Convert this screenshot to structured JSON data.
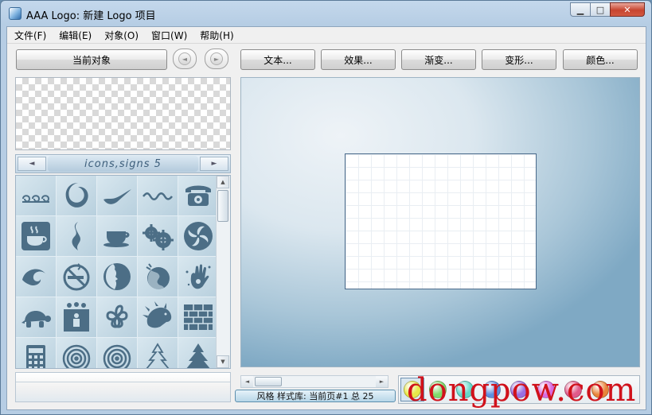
{
  "window": {
    "title": "AAA Logo: 新建 Logo 项目",
    "min_glyph": "▁",
    "max_glyph": "□",
    "close_glyph": "✕"
  },
  "menu": [
    "文件(F)",
    "编辑(E)",
    "对象(O)",
    "窗口(W)",
    "帮助(H)"
  ],
  "toolbar": {
    "current_object": "当前对象",
    "prev_glyph": "◄",
    "next_glyph": "►",
    "text": "文本...",
    "effects": "效果...",
    "gradient": "渐变...",
    "transform": "变形...",
    "color": "颜色..."
  },
  "library": {
    "title": "icons,signs 5",
    "left_glyph": "◄",
    "right_glyph": "►",
    "icons": [
      "swirls-icon",
      "swoosh-ring-icon",
      "checkmark-swoosh-icon",
      "wave-icon",
      "telephone-icon",
      "coffee-cup-steam-icon",
      "s-curve-icon",
      "cup-saucer-icon",
      "gears-icon",
      "pinwheel-icon",
      "wave-curl-icon",
      "no-smoking-icon",
      "face-profile-circle-icon",
      "globe-icon",
      "handprint-icon",
      "turtle-icon",
      "people-sign-icon",
      "clover-flower-icon",
      "hedgehog-icon",
      "brick-wall-icon",
      "calculator-icon",
      "spiral-icon",
      "spiral-icon-2",
      "christmas-tree-outline-icon",
      "christmas-tree-icon"
    ]
  },
  "status": {
    "text": "风格 样式库: 当前页#1 总 25"
  },
  "palette": {
    "colors": [
      "#e8e84a",
      "#7fd86a",
      "#62d8c8",
      "#5d8fe0",
      "#9a6ee0",
      "#d86ae0",
      "#e05a8a",
      "#e8843a"
    ]
  },
  "watermark": "dongpow.com"
}
